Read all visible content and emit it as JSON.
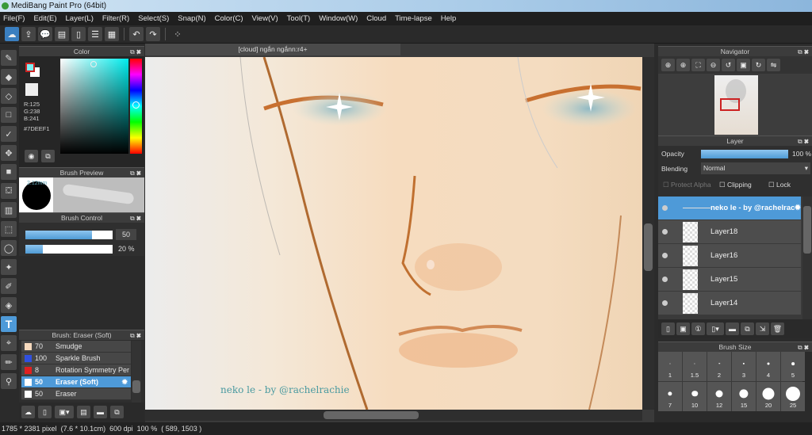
{
  "app": {
    "title": "MediBang Paint Pro (64bit)"
  },
  "menu": [
    "File(F)",
    "Edit(E)",
    "Layer(L)",
    "Filter(R)",
    "Select(S)",
    "Snap(N)",
    "Color(C)",
    "View(V)",
    "Tool(T)",
    "Window(W)",
    "Cloud",
    "Time-lapse",
    "Help"
  ],
  "color_panel": {
    "title": "Color",
    "r": "R:125",
    "g": "G:238",
    "b": "B:241",
    "hex": "#7DEEF1",
    "fg": "#7DEEF1"
  },
  "brush_preview": {
    "title": "Brush Preview",
    "size_label": "2.12mm"
  },
  "brush_control": {
    "title": "Brush Control",
    "size_value": "50",
    "size_fraction": 0.76,
    "opacity_value": "20 %",
    "opacity_fraction": 0.2
  },
  "brush_list": {
    "title": "Brush: Eraser (Soft)",
    "items": [
      {
        "size": "70",
        "name": "Smudge",
        "color": "#f6d9bd"
      },
      {
        "size": "100",
        "name": "Sparkle Brush",
        "color": "#3050e0"
      },
      {
        "size": "8",
        "name": "Rotation Symmetry Per",
        "color": "#e02020"
      },
      {
        "size": "50",
        "name": "Eraser (Soft)",
        "color": "#ffffff",
        "selected": true
      },
      {
        "size": "50",
        "name": "Eraser",
        "color": "#ffffff"
      }
    ]
  },
  "document": {
    "tab": "[cloud] ngắn ngắnn:r4+",
    "signature": "neko le - by @rachelrachie"
  },
  "navigator": {
    "title": "Navigator"
  },
  "layer_panel": {
    "title": "Layer",
    "opacity_label": "Opacity",
    "opacity_value": "100 %",
    "opacity_fraction": 1.0,
    "blending_label": "Blending",
    "blending_value": "Normal",
    "protect_alpha": "Protect Alpha",
    "clipping": "Clipping",
    "lock": "Lock",
    "layers": [
      {
        "name": "neko le - by @rachelrachie",
        "selected": true
      },
      {
        "name": "Layer18"
      },
      {
        "name": "Layer16"
      },
      {
        "name": "Layer15"
      },
      {
        "name": "Layer14"
      }
    ]
  },
  "brush_size": {
    "title": "Brush Size",
    "sizes": [
      "1",
      "1.5",
      "2",
      "3",
      "4",
      "5",
      "7",
      "10",
      "12",
      "15",
      "20",
      "25"
    ]
  },
  "status": {
    "pixels": "1785 * 2381 pixel",
    "cm": "(7.6 * 10.1cm)",
    "dpi": "600 dpi",
    "zoom": "100 %",
    "coords": "( 589, 1503 )"
  }
}
